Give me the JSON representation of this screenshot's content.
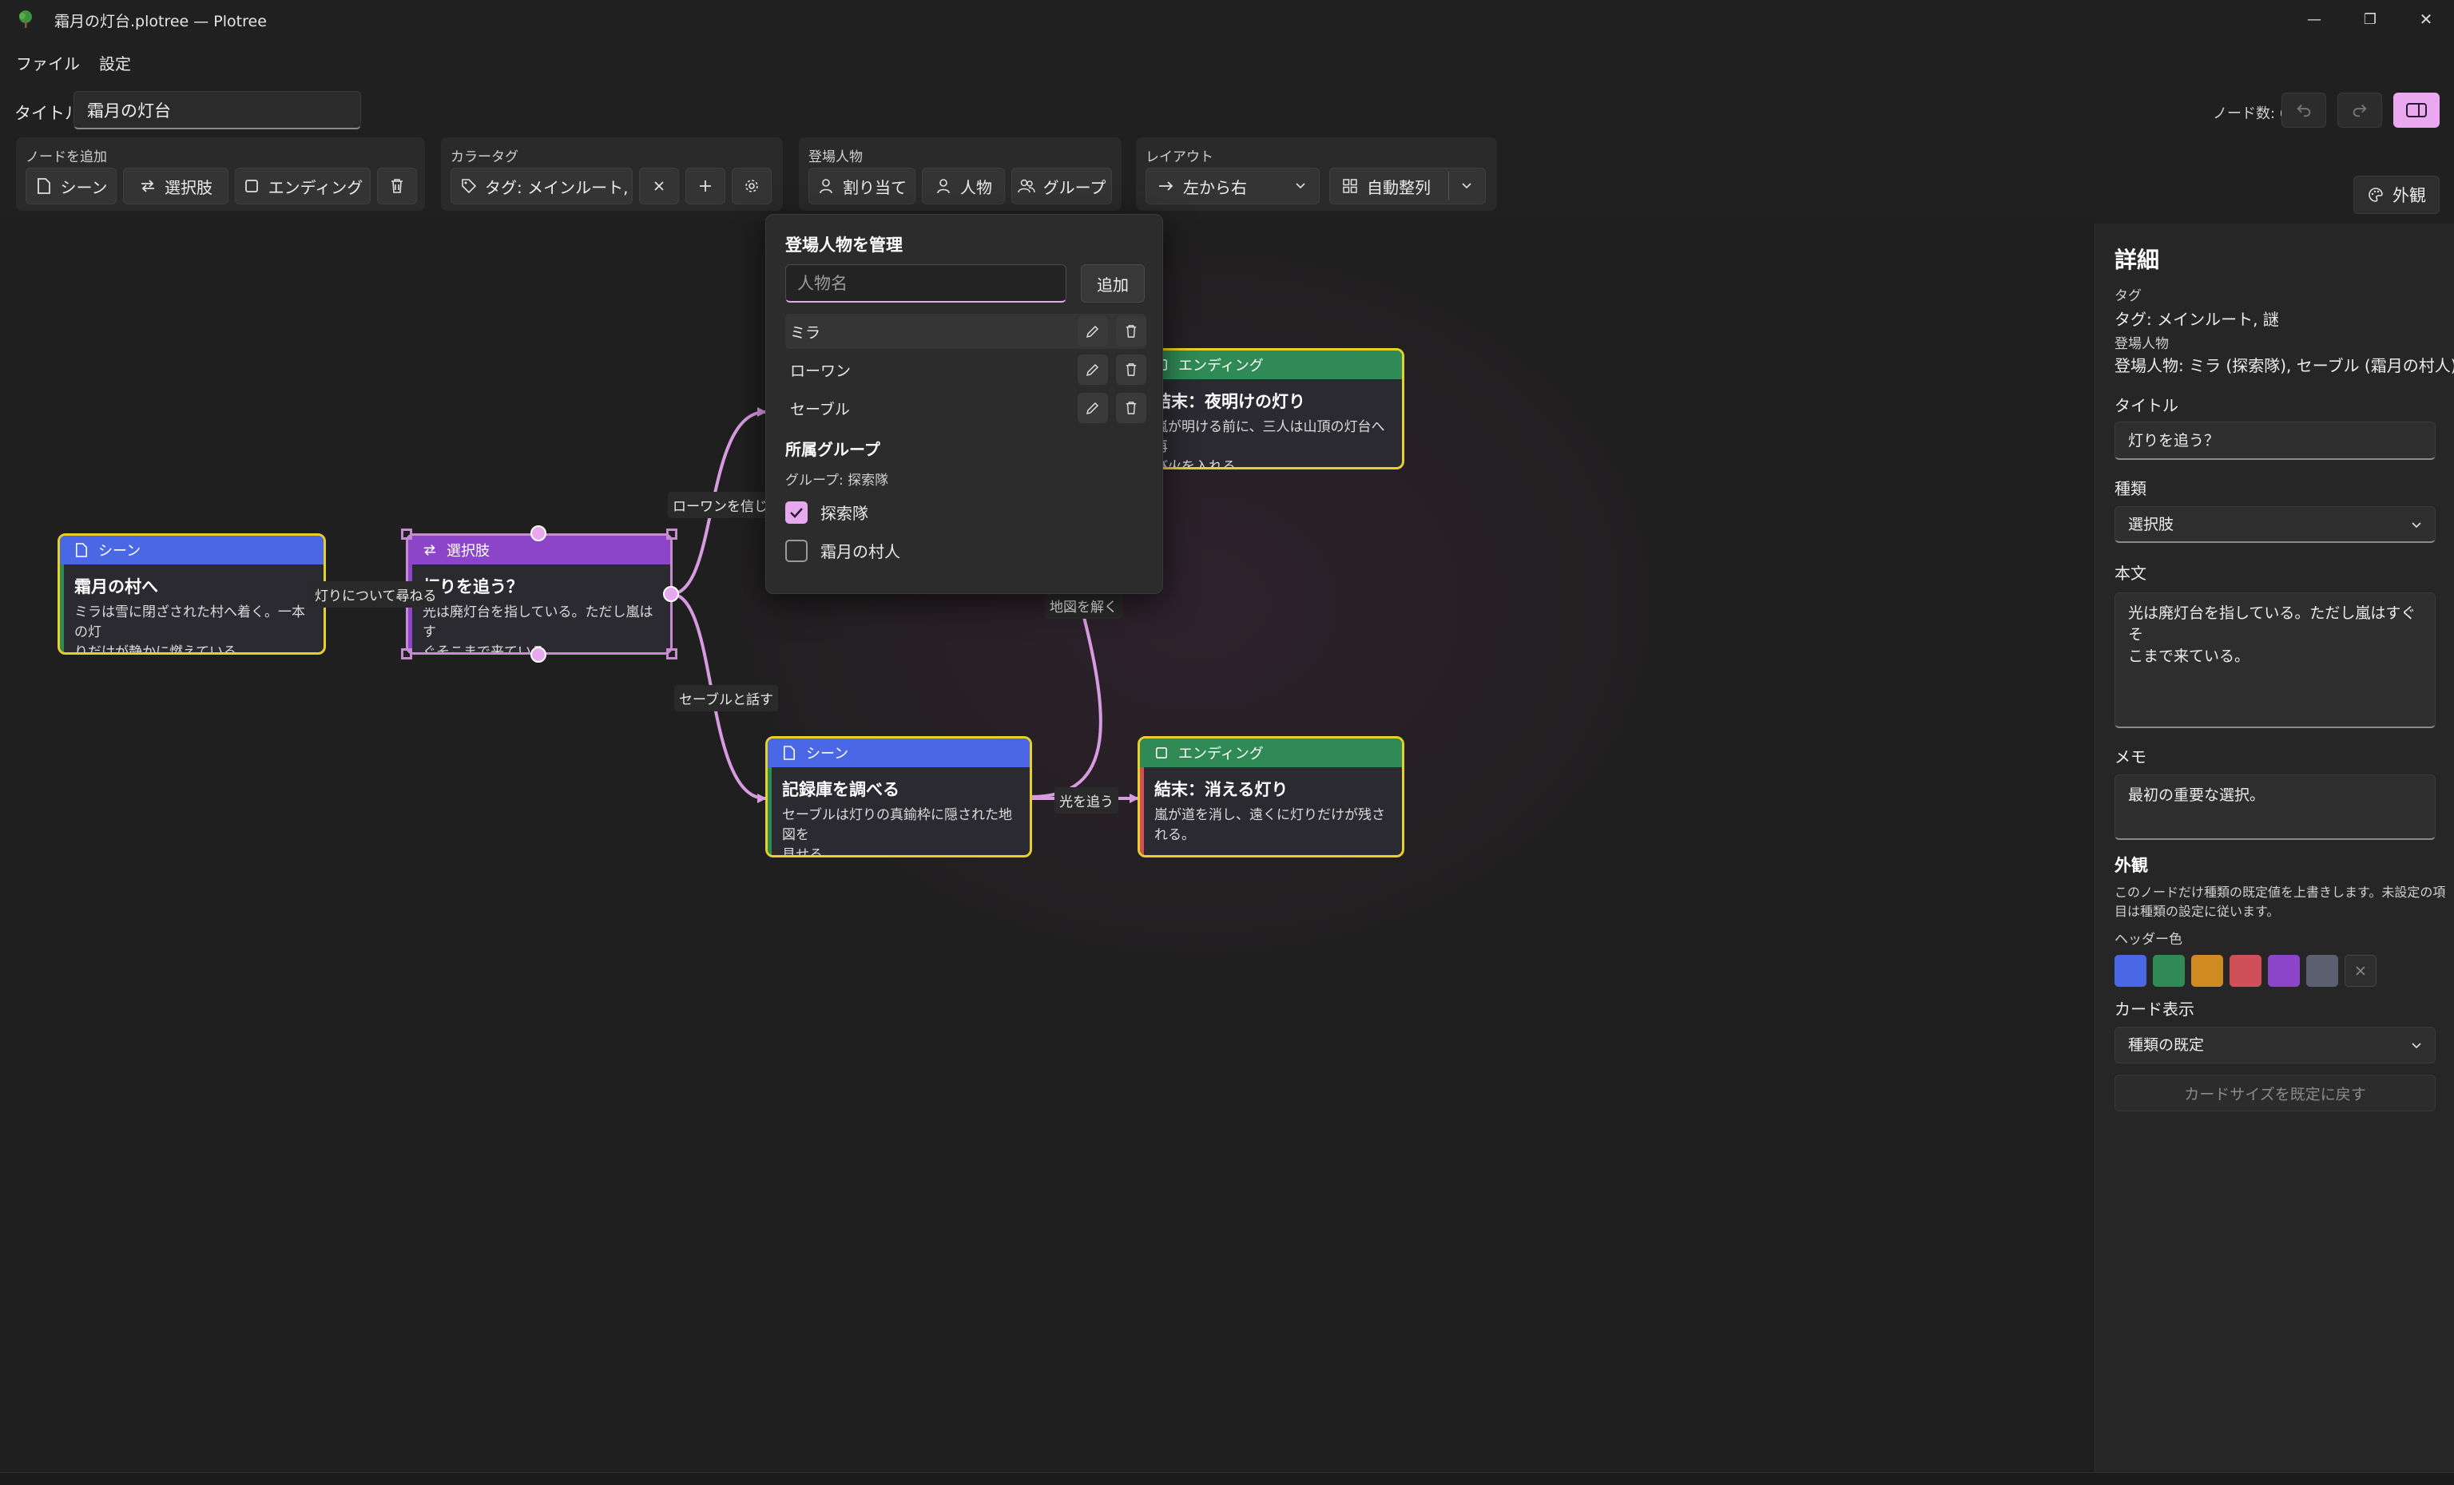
{
  "window": {
    "title": "霜月の灯台.plotree — Plotree",
    "minimize": "—",
    "restore": "❐",
    "close": "✕"
  },
  "menu": {
    "file": "ファイル",
    "settings": "設定"
  },
  "title_row": {
    "label": "タイトル",
    "value": "霜月の灯台"
  },
  "node_count": "ノード数: 6",
  "toolbar": {
    "add_node": {
      "label": "ノードを追加",
      "scene": "シーン",
      "choice": "選択肢",
      "ending": "エンディング"
    },
    "color_tag": {
      "label": "カラータグ",
      "current": "タグ: メインルート, 謎"
    },
    "characters": {
      "label": "登場人物",
      "assign": "割り当て",
      "person": "人物",
      "group": "グループ"
    },
    "layout": {
      "label": "レイアウト",
      "direction": "左から右",
      "auto_arrange": "自動整列"
    },
    "appearance": "外観"
  },
  "nodes": [
    {
      "id": "n1",
      "type": "シーン",
      "title": "霜月の村へ",
      "text": [
        "ミラは雪に閉ざされた村へ着く。一本の灯",
        "りだけが静かに燃えている。"
      ],
      "color": "#4a67e6"
    },
    {
      "id": "n2",
      "type": "選択肢",
      "title": "灯りを追う？",
      "text": [
        "光は廃灯台を指している。ただし嵐はす",
        "ぐそこまで来ている。"
      ],
      "color": "#8c45c8"
    },
    {
      "id": "n3",
      "type": "エンディング",
      "title": "結末：夜明けの灯り",
      "text": [
        "嵐が明ける前に、三人は山頂の灯台へ再",
        "び火を入れる。"
      ],
      "color": "#2f8a55"
    },
    {
      "id": "n4",
      "type": "シーン",
      "title": "記録庫を調べる",
      "text": [
        "セーブルは灯りの真鍮枠に隠された地図を",
        "見せる。"
      ],
      "color": "#4a67e6"
    },
    {
      "id": "n5",
      "type": "エンディング",
      "title": "結末：消える灯り",
      "text": [
        "嵐が道を消し、遠くに灯りだけが残される。"
      ],
      "color": "#2f8a55"
    }
  ],
  "edge_labels": {
    "e1": "灯りについて尋ねる",
    "e2": "ローワンを信じる",
    "e3": "セーブルと話す",
    "e4": "地図を解く",
    "e5": "光を追う"
  },
  "popup": {
    "title": "登場人物を管理",
    "input_placeholder": "人物名",
    "add": "追加",
    "people": [
      "ミラ",
      "ローワン",
      "セーブル"
    ],
    "group_heading": "所属グループ",
    "group_current": "グループ: 探索隊",
    "groups": [
      {
        "name": "探索隊",
        "checked": true
      },
      {
        "name": "霜月の村人",
        "checked": false
      }
    ]
  },
  "detail": {
    "heading": "詳細",
    "tag_label": "タグ",
    "tag_value": "タグ: メインルート, 謎",
    "character_label": "登場人物",
    "character_value": "登場人物: ミラ (探索隊), セーブル (霜月の村人)",
    "title_label": "タイトル",
    "title_value": "灯りを追う？",
    "type_label": "種類",
    "type_value": "選択肢",
    "body_label": "本文",
    "body_lines": [
      "光は廃灯台を指している。ただし嵐はすぐそ",
      "こまで来ている。"
    ],
    "memo_label": "メモ",
    "memo_value": "最初の重要な選択。",
    "appearance_heading": "外観",
    "appearance_desc": [
      "このノードだけ種類の既定値を上書きします。未設定の項",
      "目は種類の設定に従います。"
    ],
    "header_color_label": "ヘッダー色",
    "swatches": [
      "#4a67e6",
      "#2f8a55",
      "#d08a22",
      "#d0505a",
      "#8c45c8",
      "#5a6070"
    ],
    "card_display_label": "カード表示",
    "card_display_value": "種類の既定",
    "reset_size": "カードサイズを既定に戻す"
  },
  "colors": {
    "accent": "#e7a8ef",
    "selected_border": "#e6d02a",
    "edge": "#d79ce0"
  }
}
